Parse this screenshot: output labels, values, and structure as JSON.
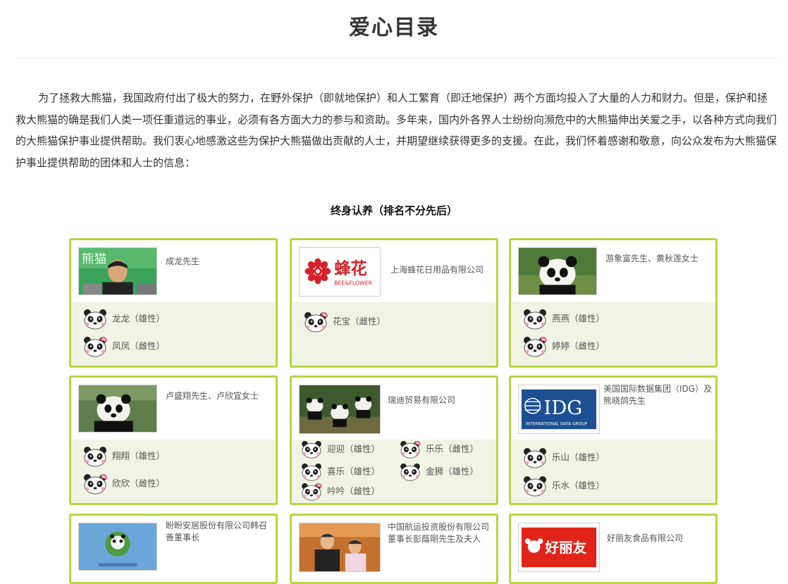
{
  "header": {
    "title": "爱心目录"
  },
  "intro": "为了拯救大熊猫，我国政府付出了极大的努力，在野外保护（即就地保护）和人工繁育（即迁地保护）两个方面均投入了大量的人力和财力。但是，保护和拯救大熊猫的确是我们人类一项任重道远的事业，必须有各方面大力的参与和资助。多年来，国内外各界人士纷纷向濒危中的大熊猫伸出关爱之手，以各种方式向我们的大熊猫保护事业提供帮助。我们衷心地感激这些为保护大熊猫做出贡献的人士，并期望继续获得更多的支援。在此，我们怀着感谢和敬意，向公众发布为大熊猫保护事业提供帮助的团体和人士的信息：",
  "section": {
    "heading": "终身认养（排名不分先后）"
  },
  "colors": {
    "card_border": "#b8d441",
    "card_bottom": "#f1f4e4",
    "title": "#333333"
  },
  "cards": [
    {
      "donor": "成龙先生",
      "image": "photo-jackie-chan",
      "pandas": [
        {
          "name": "龙龙（雄性）"
        },
        {
          "name": "凤凤（雌性）"
        }
      ]
    },
    {
      "donor": "上海蜂花日用品有限公司",
      "logo_text": "蜂花",
      "logo_subtext": "BEE&FLOWER",
      "pandas": [
        {
          "name": "花宝（雌性）"
        }
      ]
    },
    {
      "donor": "游象富先生、黄秋莲女士",
      "image": "photo-panda",
      "pandas": [
        {
          "name": "燕燕（雄性）"
        },
        {
          "name": "婷婷（雌性）"
        }
      ]
    },
    {
      "donor": "卢盛翔先生、卢欣宜女士",
      "image": "photo-panda",
      "pandas": [
        {
          "name": "翔翔（雄性）"
        },
        {
          "name": "欣欣（雌性）"
        }
      ]
    },
    {
      "donor": "瑞迪贸易有限公司",
      "image": "photo-panda-group",
      "pandas": [
        {
          "name": "迎迎（雄性）"
        },
        {
          "name": "乐乐（雌性）"
        },
        {
          "name": "喜乐（雄性）"
        },
        {
          "name": "金狮（雄性）"
        },
        {
          "name": "吟吟（雌性）"
        }
      ]
    },
    {
      "donor": "美国国际数据集团（IDG）及熊晓鸽先生",
      "logo_text": "IDG",
      "logo_subtext": "INTERNATIONAL DATA GROUP",
      "pandas": [
        {
          "name": "乐山（雄性）"
        },
        {
          "name": "乐水（雄性）"
        }
      ]
    },
    {
      "donor": "盼盼安居股份有限公司韩召善董事长",
      "image": "photo-panda-globe"
    },
    {
      "donor": "中国航运投资股份有限公司董事长彭蔭剛先生及夫人",
      "image": "photo-couple"
    },
    {
      "donor": "好丽友食品有限公司",
      "logo_text": "好丽友",
      "image": "logo-orion"
    }
  ]
}
